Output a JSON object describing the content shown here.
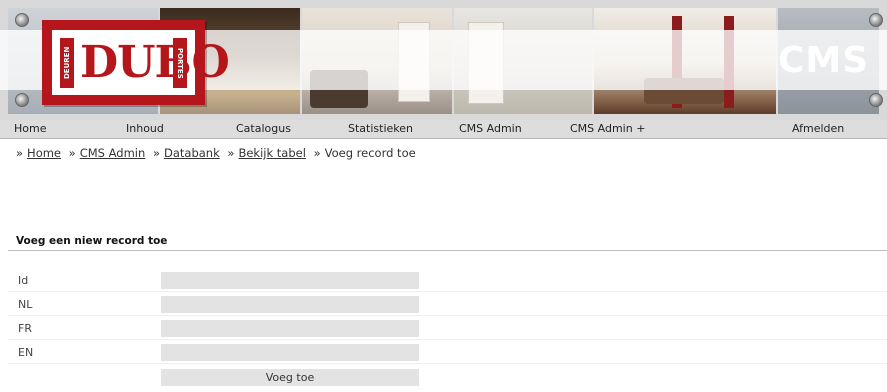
{
  "banner": {
    "logo_word": "DUBO",
    "logo_left_text": "DEUREN",
    "logo_right_text": "PORTES",
    "right_title": "CMS"
  },
  "nav": {
    "items": [
      "Home",
      "Inhoud",
      "Catalogus",
      "Statistieken",
      "CMS Admin",
      "CMS Admin +",
      "Afmelden"
    ]
  },
  "breadcrumb": {
    "sep": "»",
    "items": [
      "Home",
      "CMS Admin",
      "Databank",
      "Bekijk tabel"
    ],
    "current": "Voeg record toe"
  },
  "form": {
    "title": "Voeg een niew record toe",
    "fields": [
      {
        "label": "Id",
        "value": ""
      },
      {
        "label": "NL",
        "value": ""
      },
      {
        "label": "FR",
        "value": ""
      },
      {
        "label": "EN",
        "value": ""
      }
    ],
    "submit_label": "Voeg toe"
  }
}
